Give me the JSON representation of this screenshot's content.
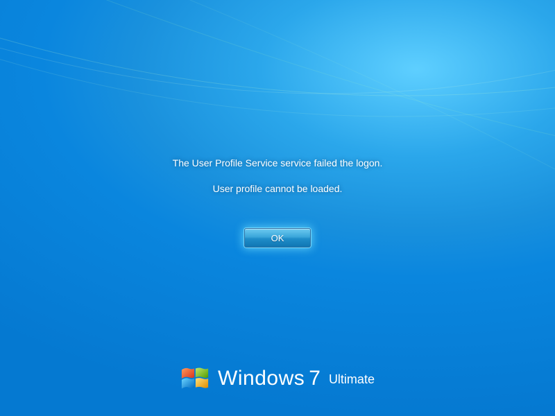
{
  "error": {
    "line1": "The User Profile Service service failed the logon.",
    "line2": "User profile cannot be loaded."
  },
  "button": {
    "ok_label": "OK"
  },
  "branding": {
    "name": "Windows",
    "number": "7",
    "edition": "Ultimate"
  },
  "colors": {
    "logo_red": "#f25022",
    "logo_green": "#7fba00",
    "logo_blue": "#00a4ef",
    "logo_yellow": "#ffb900"
  }
}
